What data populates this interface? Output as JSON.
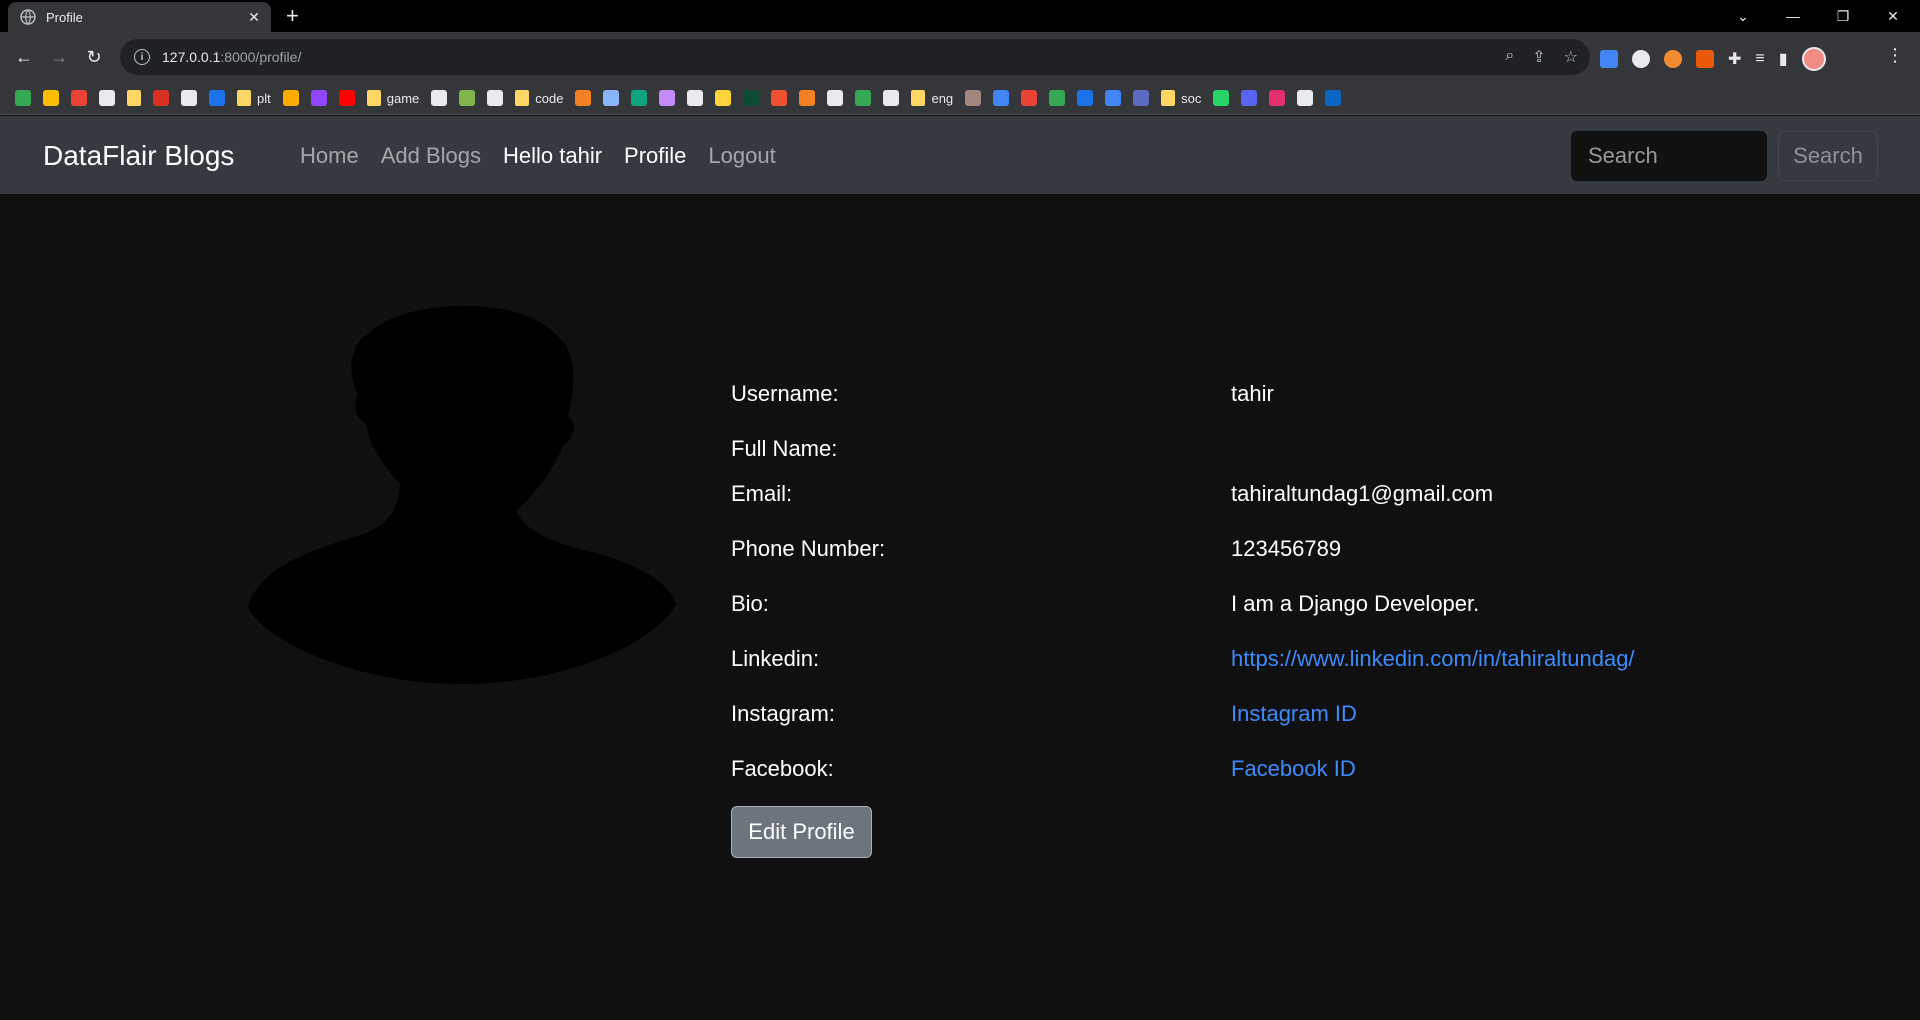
{
  "browser": {
    "tab_title": "Profile",
    "new_tab": "+",
    "url_host": "127.0.0.1",
    "url_path": ":8000/profile/",
    "bookmarks": [
      {
        "type": "icon",
        "icon": "maps-icon",
        "color": "#34a853"
      },
      {
        "type": "icon",
        "icon": "keep-icon",
        "color": "#fbbc04"
      },
      {
        "type": "icon",
        "icon": "gmail-icon",
        "color": "#ea4335"
      },
      {
        "type": "icon",
        "icon": "globe-icon",
        "color": "#e8eaed"
      },
      {
        "type": "folder",
        "label": ""
      },
      {
        "type": "icon",
        "icon": "l-icon",
        "color": "#d93025"
      },
      {
        "type": "icon",
        "icon": "speed-icon",
        "color": "#e8eaed"
      },
      {
        "type": "icon",
        "icon": "w-icon",
        "color": "#1a73e8"
      },
      {
        "type": "folder",
        "label": "plt"
      },
      {
        "type": "icon",
        "icon": "play-icon",
        "color": "#f9ab00"
      },
      {
        "type": "icon",
        "icon": "twitch-icon",
        "color": "#9146ff"
      },
      {
        "type": "icon",
        "icon": "youtube-icon",
        "color": "#ff0000"
      },
      {
        "type": "folder",
        "label": "game"
      },
      {
        "type": "icon",
        "icon": "hp-icon",
        "color": "#e8eaed"
      },
      {
        "type": "icon",
        "icon": "chess-icon",
        "color": "#81b64c"
      },
      {
        "type": "icon",
        "icon": "chatgpt-icon",
        "color": "#e8eaed"
      },
      {
        "type": "folder",
        "label": "code"
      },
      {
        "type": "icon",
        "icon": "stack-icon",
        "color": "#f48024"
      },
      {
        "type": "icon",
        "icon": "gemini-icon",
        "color": "#8ab4f8"
      },
      {
        "type": "icon",
        "icon": "openai-icon",
        "color": "#10a37f"
      },
      {
        "type": "icon",
        "icon": "bot-icon",
        "color": "#c58af9"
      },
      {
        "type": "icon",
        "icon": "github-icon",
        "color": "#e8eaed"
      },
      {
        "type": "icon",
        "icon": "python-icon",
        "color": "#ffd43b"
      },
      {
        "type": "icon",
        "icon": "django-icon",
        "color": "#0c4b33"
      },
      {
        "type": "icon",
        "icon": "blocks-icon",
        "color": "#f05032"
      },
      {
        "type": "icon",
        "icon": "layers-icon",
        "color": "#f48024"
      },
      {
        "type": "icon",
        "icon": "frame-icon",
        "color": "#e8eaed"
      },
      {
        "type": "icon",
        "icon": "cycle-icon",
        "color": "#34a853"
      },
      {
        "type": "icon",
        "icon": "grid-icon",
        "color": "#e8eaed"
      },
      {
        "type": "folder",
        "label": "eng"
      },
      {
        "type": "icon",
        "icon": "face-icon",
        "color": "#a1887f"
      },
      {
        "type": "icon",
        "icon": "ring-icon",
        "color": "#4285f4"
      },
      {
        "type": "icon",
        "icon": "video-icon",
        "color": "#ea4335"
      },
      {
        "type": "icon",
        "icon": "people-icon",
        "color": "#34a853"
      },
      {
        "type": "icon",
        "icon": "shield-icon",
        "color": "#1a73e8"
      },
      {
        "type": "icon",
        "icon": "translate-icon",
        "color": "#4285f4"
      },
      {
        "type": "icon",
        "icon": "vocab-icon",
        "color": "#5c6bc0"
      },
      {
        "type": "folder",
        "label": "soc"
      },
      {
        "type": "icon",
        "icon": "whatsapp-icon",
        "color": "#25d366"
      },
      {
        "type": "icon",
        "icon": "discord-icon",
        "color": "#5865f2"
      },
      {
        "type": "icon",
        "icon": "instagram-icon",
        "color": "#e1306c"
      },
      {
        "type": "icon",
        "icon": "x-icon",
        "color": "#e8eaed"
      },
      {
        "type": "icon",
        "icon": "linkedin-icon",
        "color": "#0a66c2"
      }
    ]
  },
  "site": {
    "brand": "DataFlair Blogs",
    "nav": [
      "Home",
      "Add Blogs",
      "Hello tahir",
      "Profile",
      "Logout"
    ],
    "search_placeholder": "Search",
    "search_button": "Search"
  },
  "profile": {
    "rows": [
      {
        "label": "Username:",
        "value": "tahir"
      },
      {
        "label": "Full Name:",
        "value": ""
      },
      {
        "label": "Email:",
        "value": "tahiraltundag1@gmail.com"
      },
      {
        "label": "Phone Number:",
        "value": "123456789"
      },
      {
        "label": "Bio:",
        "value": "I am a Django Developer."
      },
      {
        "label": "Linkedin:",
        "value": "https://www.linkedin.com/in/tahiraltundag/"
      },
      {
        "label": "Instagram:",
        "value": "Instagram ID"
      },
      {
        "label": "Facebook:",
        "value": "Facebook ID"
      }
    ],
    "edit_button": "Edit Profile"
  },
  "colors": {
    "navbar_bg": "#343a40",
    "page_bg": "#101010",
    "link": "#3d8bfd",
    "button_bg": "#6c757d"
  }
}
